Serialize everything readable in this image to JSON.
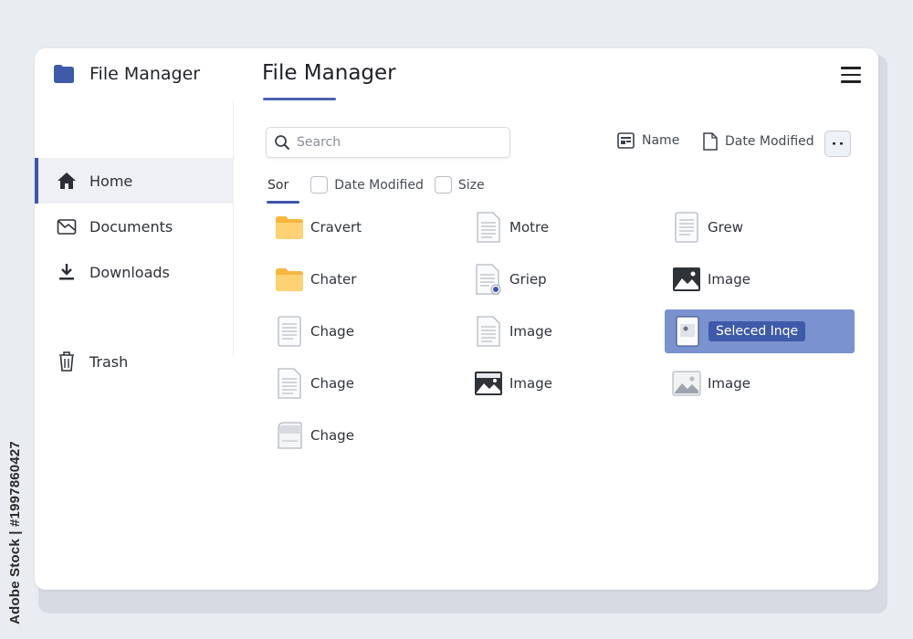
{
  "watermark": {
    "stock_id": "Adobe Stock | #1997860427"
  },
  "app": {
    "brand_name": "File Manager",
    "header_title": "File Manager"
  },
  "sidebar": {
    "items": [
      {
        "label": "Home",
        "icon": "home-icon",
        "active": true
      },
      {
        "label": "Documents",
        "icon": "documents-icon",
        "active": false
      },
      {
        "label": "Downloads",
        "icon": "download-icon",
        "active": false
      },
      {
        "label": "Trash",
        "icon": "trash-icon",
        "active": false
      }
    ]
  },
  "search": {
    "placeholder": "Search",
    "value": ""
  },
  "sort_top": {
    "name_label": "Name",
    "date_label": "Date Modified"
  },
  "sort_row": {
    "sort_tab": "Sor",
    "date_option": "Date Modified",
    "size_option": "Size"
  },
  "files": [
    {
      "name": "Cravert",
      "icon": "folder-icon"
    },
    {
      "name": "Motre",
      "icon": "document-icon"
    },
    {
      "name": "Grew",
      "icon": "document-icon"
    },
    {
      "name": "Chater",
      "icon": "folder-icon"
    },
    {
      "name": "Griep",
      "icon": "document-badge-icon"
    },
    {
      "name": "Image",
      "icon": "image-icon"
    },
    {
      "name": "Chage",
      "icon": "document-icon"
    },
    {
      "name": "Image",
      "icon": "document-icon"
    },
    {
      "name": "Seleced Inqe",
      "icon": "image-file-icon",
      "selected": true
    },
    {
      "name": "Chage",
      "icon": "document-icon"
    },
    {
      "name": "Image",
      "icon": "image-icon"
    },
    {
      "name": "Image",
      "icon": "image-light-icon"
    },
    {
      "name": "Chage",
      "icon": "drive-icon"
    }
  ],
  "colors": {
    "accent": "#3d56a8",
    "selection": "#7a92cf",
    "folder": "#fbc85a"
  }
}
